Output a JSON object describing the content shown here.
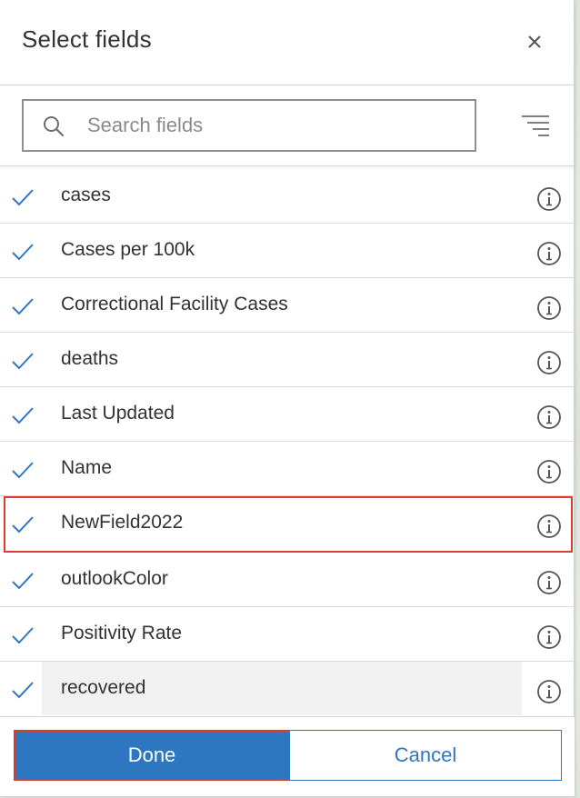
{
  "dialog": {
    "title": "Select fields",
    "close_icon": "close-icon"
  },
  "search": {
    "placeholder": "Search fields",
    "value": "",
    "icon": "search-icon",
    "filter_icon": "filter-list-icon"
  },
  "fields": [
    {
      "label": "cases",
      "checked": true
    },
    {
      "label": "Cases per 100k",
      "checked": true
    },
    {
      "label": "Correctional Facility Cases",
      "checked": true
    },
    {
      "label": "deaths",
      "checked": true
    },
    {
      "label": "Last Updated",
      "checked": true
    },
    {
      "label": "Name",
      "checked": true
    },
    {
      "label": "NewField2022",
      "checked": true,
      "highlighted": true
    },
    {
      "label": "outlookColor",
      "checked": true
    },
    {
      "label": "Positivity Rate",
      "checked": true
    },
    {
      "label": "recovered",
      "checked": true,
      "hovered": true
    }
  ],
  "footer": {
    "done_label": "Done",
    "cancel_label": "Cancel"
  },
  "colors": {
    "accent": "#2d77c0",
    "highlight_outline": "#de3b2c",
    "text": "#323232"
  }
}
